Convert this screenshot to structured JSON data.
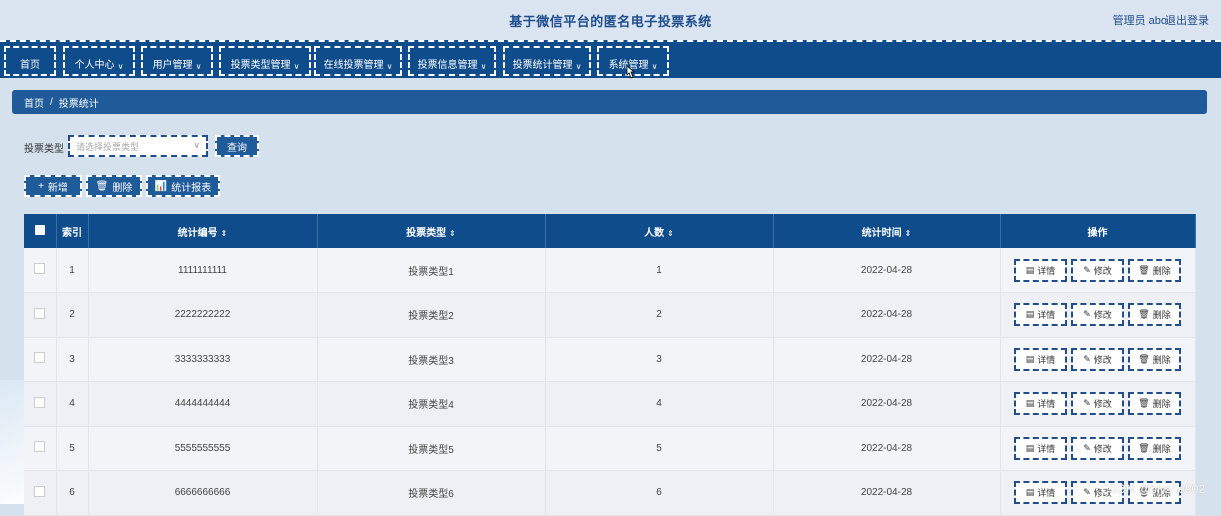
{
  "header": {
    "title": "基于微信平台的匿名电子投票系统",
    "user": "管理员 abo",
    "logout": "退出登录"
  },
  "nav": {
    "items": [
      {
        "label": "首页",
        "chevron": false
      },
      {
        "label": "个人中心",
        "chevron": true
      },
      {
        "label": "用户管理",
        "chevron": true
      },
      {
        "label": "投票类型管理",
        "chevron": true
      },
      {
        "label": "在线投票管理",
        "chevron": true
      },
      {
        "label": "投票信息管理",
        "chevron": true
      },
      {
        "label": "投票统计管理",
        "chevron": true
      },
      {
        "label": "系统管理",
        "chevron": true
      }
    ],
    "chevron_glyph": "∨"
  },
  "breadcrumb": {
    "home": "首页",
    "separator": "/",
    "current": "投票统计"
  },
  "search": {
    "label": "投票类型",
    "placeholder": "请选择投票类型",
    "query_button": "查询"
  },
  "toolbar": {
    "add_icon": "+",
    "add_label": "新增",
    "delete_icon": "🗑",
    "delete_label": "删除",
    "report_icon": "📊",
    "report_label": "统计报表"
  },
  "table": {
    "headers": {
      "index": "索引",
      "code": "统计编号",
      "type": "投票类型",
      "count": "人数",
      "time": "统计时间",
      "ops": "操作"
    },
    "sort_glyph": "⇕",
    "rows": [
      {
        "index": "1",
        "code": "1111111111",
        "type": "投票类型1",
        "count": "1",
        "time": "2022-04-28"
      },
      {
        "index": "2",
        "code": "2222222222",
        "type": "投票类型2",
        "count": "2",
        "time": "2022-04-28"
      },
      {
        "index": "3",
        "code": "3333333333",
        "type": "投票类型3",
        "count": "3",
        "time": "2022-04-28"
      },
      {
        "index": "4",
        "code": "4444444444",
        "type": "投票类型4",
        "count": "4",
        "time": "2022-04-28"
      },
      {
        "index": "5",
        "code": "5555555555",
        "type": "投票类型5",
        "count": "5",
        "time": "2022-04-28"
      },
      {
        "index": "6",
        "code": "6666666666",
        "type": "投票类型6",
        "count": "6",
        "time": "2022-04-28"
      }
    ],
    "row_actions": {
      "detail_icon": "▤",
      "detail": "详情",
      "edit_icon": "✎",
      "edit": "修改",
      "delete_icon": "🗑",
      "delete": "删除"
    }
  },
  "watermark": "CSDN @biyshe902",
  "colors": {
    "nav_bg": "#0f4c8c",
    "accent": "#1f5a99",
    "title": "#1f4d8e",
    "page_bg": "#d6e1ee"
  }
}
